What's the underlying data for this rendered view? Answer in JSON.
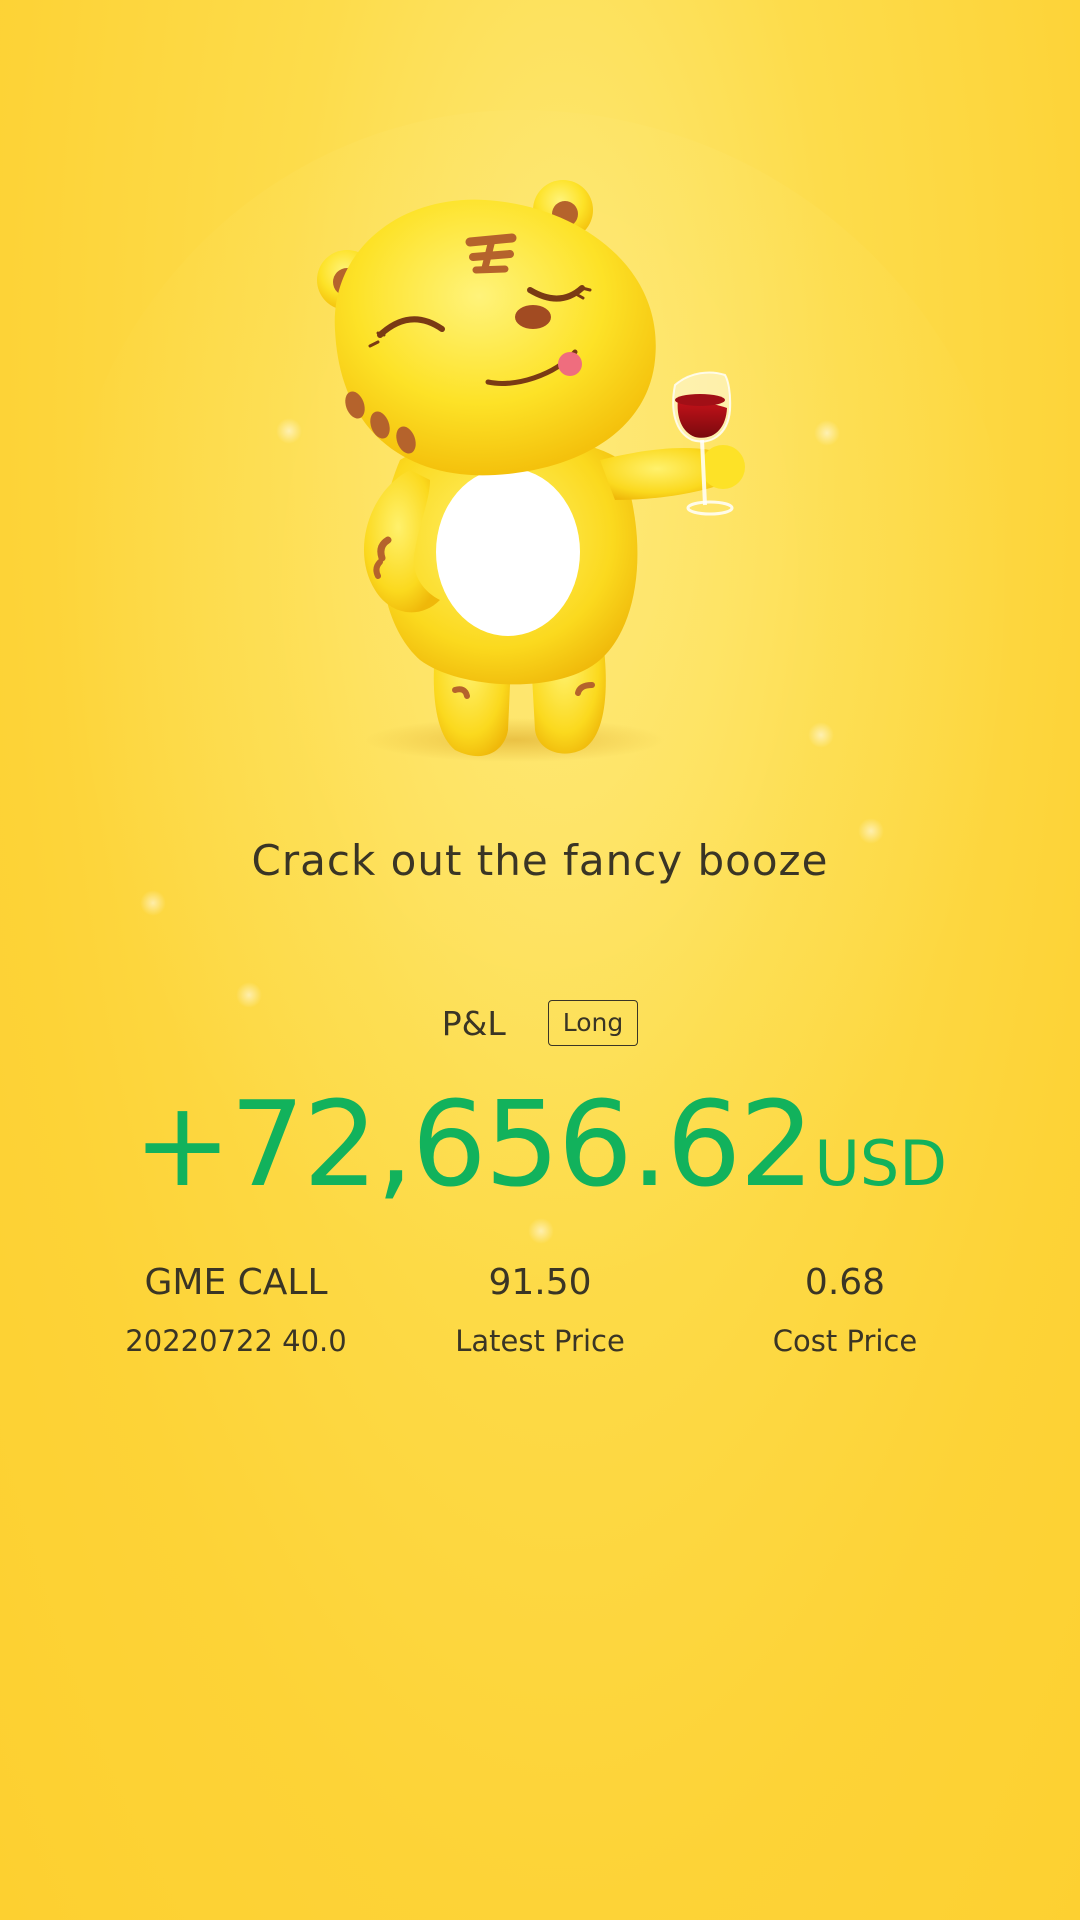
{
  "headline": "Crack out the fancy booze",
  "mascot": "tiger-mascot-holding-wine-glass",
  "position": {
    "pl_label": "P&L",
    "side_badge": "Long"
  },
  "pnl": {
    "amount": "+72,656.62",
    "currency": "USD",
    "color": "#12b25c"
  },
  "stats": {
    "contract": {
      "name": "GME CALL",
      "detail": "20220722 40.0"
    },
    "latest_price": {
      "value": "91.50",
      "label": "Latest Price"
    },
    "cost_price": {
      "value": "0.68",
      "label": "Cost Price"
    }
  },
  "colors": {
    "background": "#fdd337",
    "text": "#3a3525",
    "profit": "#12b25c"
  }
}
